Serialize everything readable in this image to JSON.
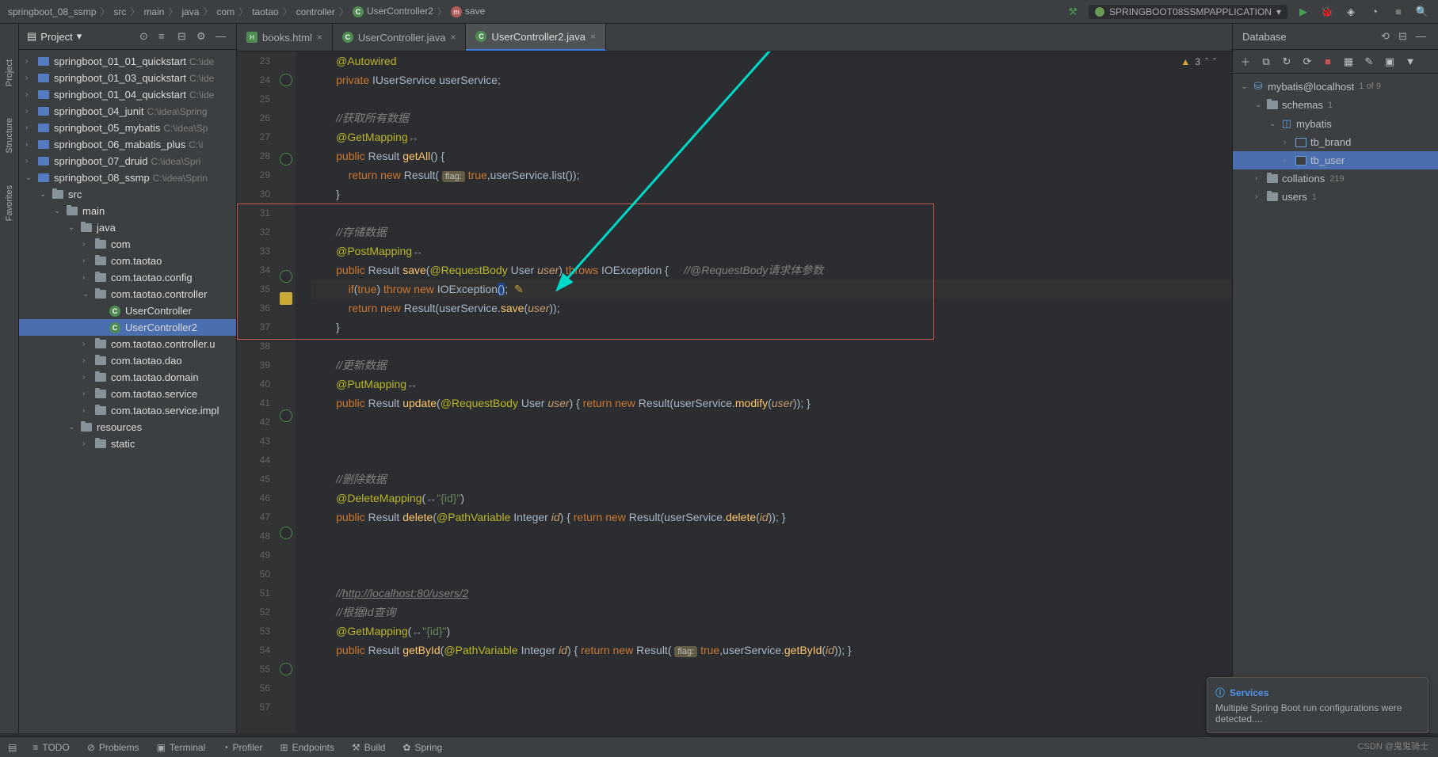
{
  "breadcrumb": [
    "springboot_08_ssmp",
    "src",
    "main",
    "java",
    "com",
    "taotao",
    "controller",
    "UserController2",
    "save"
  ],
  "runConfig": "SPRINGBOOT08SSMPAPPLICATION",
  "projectPanel": {
    "title": "Project"
  },
  "projectTree": [
    {
      "i": 0,
      "a": "›",
      "t": "m",
      "n": "springboot_01_01_quickstart",
      "p": "C:\\ide"
    },
    {
      "i": 0,
      "a": "›",
      "t": "m",
      "n": "springboot_01_03_quickstart",
      "p": "C:\\ide"
    },
    {
      "i": 0,
      "a": "›",
      "t": "m",
      "n": "springboot_01_04_quickstart",
      "p": "C:\\ide"
    },
    {
      "i": 0,
      "a": "›",
      "t": "m",
      "n": "springboot_04_junit",
      "p": "C:\\idea\\Spring"
    },
    {
      "i": 0,
      "a": "›",
      "t": "m",
      "n": "springboot_05_mybatis",
      "p": "C:\\idea\\Sp"
    },
    {
      "i": 0,
      "a": "›",
      "t": "m",
      "n": "springboot_06_mabatis_plus",
      "p": "C:\\i"
    },
    {
      "i": 0,
      "a": "›",
      "t": "m",
      "n": "springboot_07_druid",
      "p": "C:\\idea\\Spri"
    },
    {
      "i": 0,
      "a": "⌄",
      "t": "m",
      "n": "springboot_08_ssmp",
      "p": "C:\\idea\\Sprin"
    },
    {
      "i": 1,
      "a": "⌄",
      "t": "f",
      "n": "src"
    },
    {
      "i": 2,
      "a": "⌄",
      "t": "f",
      "n": "main"
    },
    {
      "i": 3,
      "a": "⌄",
      "t": "f",
      "n": "java"
    },
    {
      "i": 4,
      "a": "›",
      "t": "f",
      "n": "com"
    },
    {
      "i": 4,
      "a": "›",
      "t": "f",
      "n": "com.taotao"
    },
    {
      "i": 4,
      "a": "›",
      "t": "f",
      "n": "com.taotao.config"
    },
    {
      "i": 4,
      "a": "⌄",
      "t": "f",
      "n": "com.taotao.controller"
    },
    {
      "i": 5,
      "a": "",
      "t": "c",
      "n": "UserController"
    },
    {
      "i": 5,
      "a": "",
      "t": "c",
      "n": "UserController2",
      "sel": true
    },
    {
      "i": 4,
      "a": "›",
      "t": "f",
      "n": "com.taotao.controller.u"
    },
    {
      "i": 4,
      "a": "›",
      "t": "f",
      "n": "com.taotao.dao"
    },
    {
      "i": 4,
      "a": "›",
      "t": "f",
      "n": "com.taotao.domain"
    },
    {
      "i": 4,
      "a": "›",
      "t": "f",
      "n": "com.taotao.service"
    },
    {
      "i": 4,
      "a": "›",
      "t": "f",
      "n": "com.taotao.service.impl"
    },
    {
      "i": 3,
      "a": "⌄",
      "t": "f",
      "n": "resources"
    },
    {
      "i": 4,
      "a": "›",
      "t": "f",
      "n": "static"
    }
  ],
  "tabs": [
    {
      "label": "books.html",
      "type": "html"
    },
    {
      "label": "UserController.java",
      "type": "java"
    },
    {
      "label": "UserController2.java",
      "type": "java",
      "active": true
    }
  ],
  "warnCount": "3",
  "lines": {
    "start": 23,
    "end": 57,
    "23": "@Autowired",
    "24": "private IUserService userService;",
    "26cm": "//获取所有数据",
    "27": "@GetMapping",
    "28": "public Result getAll() {",
    "29": "    return new Result( flag: true,userService.list());",
    "30": "}",
    "32cm": "//存储数据",
    "33": "@PostMapping",
    "34": "public Result save(@RequestBody User user) throws IOException {",
    "34cm": "//@RequestBody请求体参数",
    "35": "    if(true) throw new IOException();",
    "36": "    return new Result(userService.save(user));",
    "37": "}",
    "39cm": "//更新数据",
    "40": "@PutMapping",
    "41": "public Result update(@RequestBody User user) { return new Result(userService.modify(user)); }",
    "45cm": "//删除数据",
    "46": "@DeleteMapping(\"{id}\")",
    "47": "public Result delete(@PathVariable Integer id) { return new Result(userService.delete(id)); }",
    "51cm": "//http://localhost:80/users/2",
    "52cm": "//根据Id查询",
    "53": "@GetMapping(\"{id}\")",
    "54": "public Result getById(@PathVariable Integer id) { return new Result( flag: true,userService.getById(id)); }"
  },
  "database": {
    "title": "Database",
    "conn": "mybatis@localhost",
    "connBadge": "1 of 9",
    "tree": [
      {
        "i": 0,
        "a": "⌄",
        "n": "mybatis@localhost",
        "badge": "1 of 9",
        "icon": "ds"
      },
      {
        "i": 1,
        "a": "⌄",
        "n": "schemas",
        "badge": "1",
        "icon": "f"
      },
      {
        "i": 2,
        "a": "⌄",
        "n": "mybatis",
        "icon": "sch"
      },
      {
        "i": 3,
        "a": "›",
        "n": "tb_brand",
        "icon": "tbl"
      },
      {
        "i": 3,
        "a": "›",
        "n": "tb_user",
        "icon": "tbl",
        "sel": true
      },
      {
        "i": 1,
        "a": "›",
        "n": "collations",
        "badge": "219",
        "icon": "f"
      },
      {
        "i": 1,
        "a": "›",
        "n": "users",
        "badge": "1",
        "icon": "f"
      }
    ]
  },
  "notify": {
    "title": "Services",
    "body": "Multiple Spring Boot run configurations were detected...."
  },
  "bottom": [
    "TODO",
    "Problems",
    "Terminal",
    "Profiler",
    "Endpoints",
    "Build",
    "Spring"
  ],
  "watermark": "CSDN @鬼鬼骑士"
}
